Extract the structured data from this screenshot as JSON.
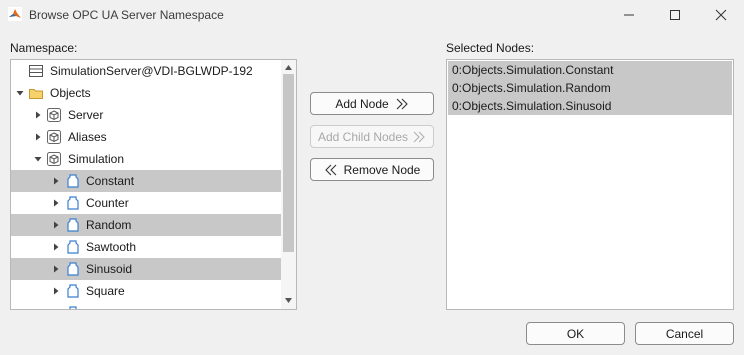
{
  "window": {
    "title": "Browse OPC UA Server Namespace"
  },
  "namespace_label": "Namespace:",
  "selected_label": "Selected Nodes:",
  "tree": {
    "server_item": "SimulationServer@VDI-BGLWDP-192",
    "objects_item": "Objects",
    "server_node": "Server",
    "aliases_node": "Aliases",
    "simulation_node": "Simulation",
    "constant": "Constant",
    "counter": "Counter",
    "random": "Random",
    "sawtooth": "Sawtooth",
    "sinusoid": "Sinusoid",
    "square": "Square"
  },
  "buttons": {
    "add_node": "Add Node",
    "add_child_nodes": "Add Child Nodes",
    "remove_node": "Remove Node",
    "ok": "OK",
    "cancel": "Cancel"
  },
  "selected_nodes": [
    "0:Objects.Simulation.Constant",
    "0:Objects.Simulation.Random",
    "0:Objects.Simulation.Sinusoid"
  ],
  "colors": {
    "selection": "#c8c8c8",
    "folder": "#e8b33a",
    "variable": "#3a7fd0",
    "object": "#555555"
  }
}
